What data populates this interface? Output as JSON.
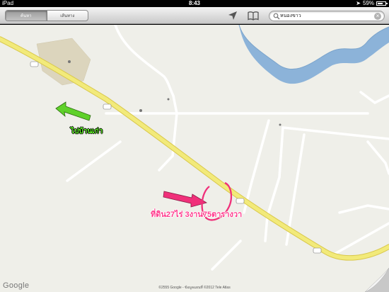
{
  "status_bar": {
    "device": "iPad",
    "time": "8:43",
    "battery_text": "59%",
    "battery_level": 0.59
  },
  "toolbar": {
    "segments": [
      "ค้นหา",
      "เส้นทาง"
    ],
    "active_segment": 0,
    "search": {
      "value": "หนองขาว"
    }
  },
  "map": {
    "place_labels": [
      "",
      "",
      "",
      ""
    ],
    "road_shields": [
      "",
      "",
      "",
      ""
    ],
    "annotations": {
      "old_home": "ไปบ้านเก่า",
      "land": "ที่ดิน27ไร่ 3งาน75ตารางวา"
    },
    "colors": {
      "arrow_old_home": "#5fd12a",
      "arrow_land": "#f0307a",
      "highway": "#f2ea7a",
      "river": "#8cb3d9"
    }
  },
  "footer": {
    "logo": "Google",
    "copyright": "©2555 Google - ข้อมูลแผนที่ ©2012 Tele Atlas"
  }
}
